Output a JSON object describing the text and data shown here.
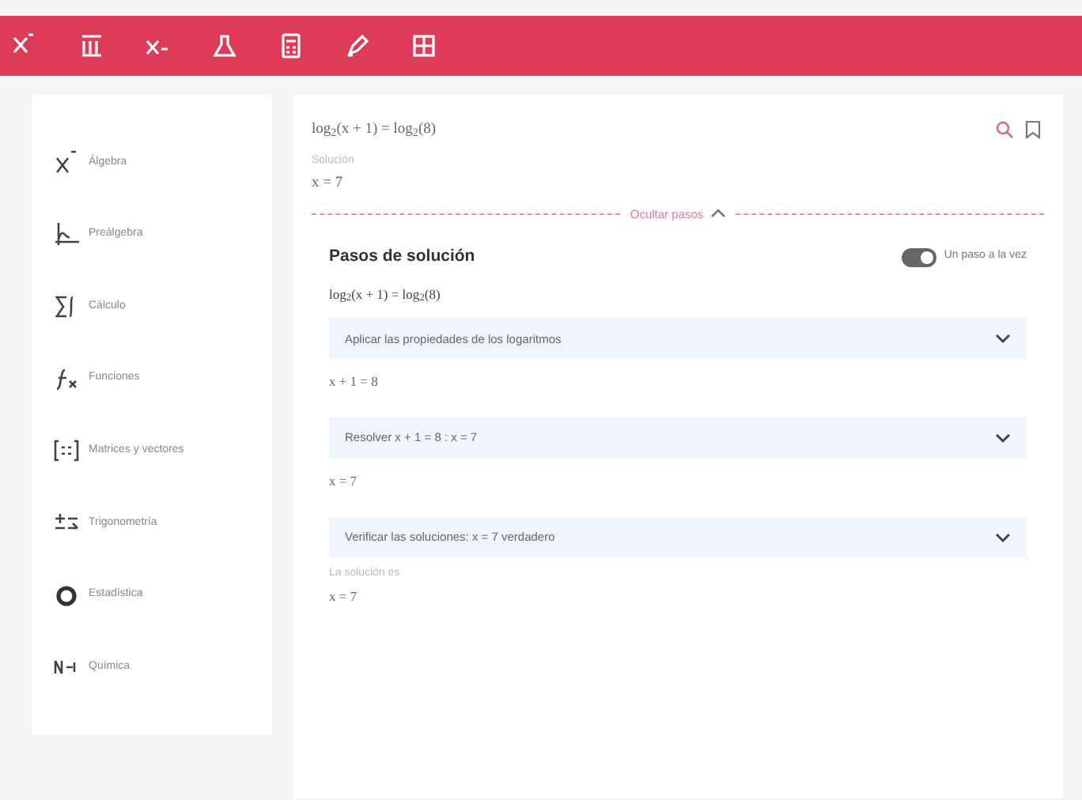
{
  "sidebar": {
    "items": [
      {
        "label": "Álgebra"
      },
      {
        "label": "Preálgebra"
      },
      {
        "label": "Cálculo"
      },
      {
        "label": "Funciones"
      },
      {
        "label": "Matrices y vectores"
      },
      {
        "label": "Trigonometría"
      },
      {
        "label": "Estadística"
      },
      {
        "label": "Química"
      }
    ]
  },
  "problem": {
    "equation": "log$_{2}$(x + 1) = log$_{2}$(8)",
    "solution_label": "Solución",
    "solution": "x = 7"
  },
  "steps_toggle": {
    "label": "Ocultar pasos",
    "expanded": true
  },
  "steps_panel": {
    "title": "Pasos de solución",
    "switch": {
      "label": "Un paso a la vez",
      "on": true
    },
    "start": "log$_{2}$(x + 1) = log$_{2}$(8)",
    "steps": [
      {
        "title": "Aplicar las propiedades de los logaritmos",
        "expanded": false,
        "result": "x + 1 = 8"
      },
      {
        "title": "Resolver  x + 1 = 8 :  x = 7",
        "expanded": false,
        "result": "x = 7"
      },
      {
        "title": "Verificar las soluciones:  x = 7 verdadero",
        "expanded": false,
        "result_label": "La solución es",
        "result": "x = 7"
      }
    ]
  }
}
